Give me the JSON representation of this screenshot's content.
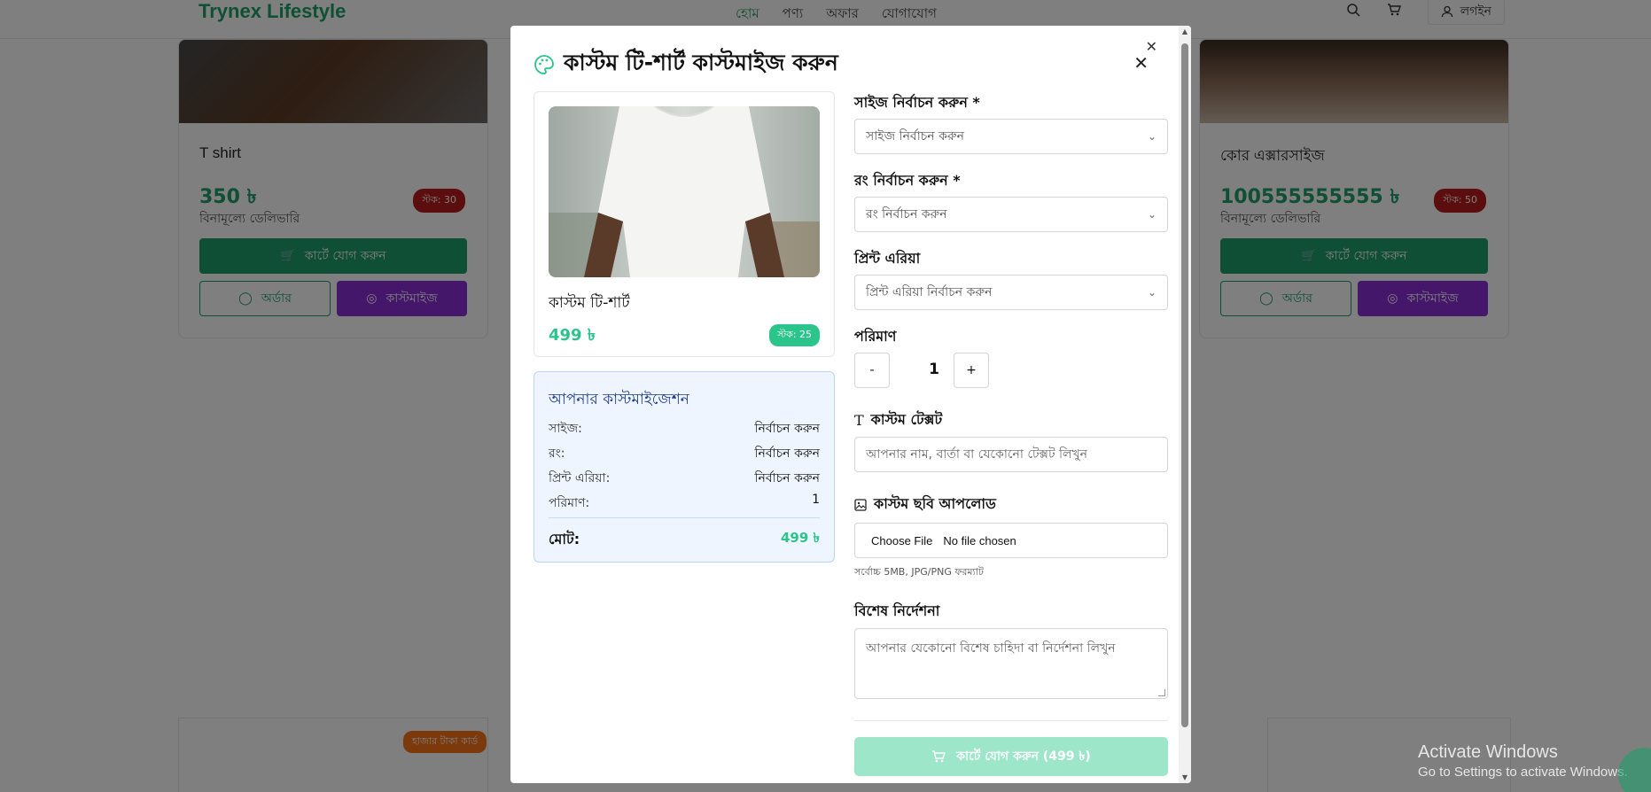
{
  "background": {
    "brand": "Trynex Lifestyle",
    "nav": [
      "হোম",
      "পণ্য",
      "অফার",
      "যোগাযোগ"
    ],
    "login_label": "লগইন",
    "cards": [
      {
        "title": "T shirt",
        "price": "350 ৳",
        "delivery": "বিনামূল্যে ডেলিভারি",
        "stock": "স্টক: 30",
        "add_to_cart": "কার্টে যোগ করুন",
        "order": "অর্ডার",
        "customize": "কাস্টমাইজ"
      },
      {
        "title": "কোর এক্সারসাইজ",
        "price": "100555555555 ৳",
        "delivery": "বিনামূল্যে ডেলিভারি",
        "stock": "স্টক: 50",
        "add_to_cart": "কার্টে যোগ করুন",
        "order": "অর্ডার",
        "customize": "কাস্টমাইজ"
      }
    ],
    "lower_badge": "হাজার টাকা কার্ড"
  },
  "modal": {
    "title": "কাস্টম টি-শার্ট কাস্টমাইজ করুন",
    "product": {
      "name": "কাস্টম টি-শার্ট",
      "price": "499 ৳",
      "stock": "স্টক: 25"
    },
    "summary": {
      "title": "আপনার কাস্টমাইজেশন",
      "rows": [
        {
          "label": "সাইজ:",
          "value": "নির্বাচন করুন"
        },
        {
          "label": "রং:",
          "value": "নির্বাচন করুন"
        },
        {
          "label": "প্রিন্ট এরিয়া:",
          "value": "নির্বাচন করুন"
        },
        {
          "label": "পরিমাণ:",
          "value": "1"
        }
      ],
      "total_label": "মোট:",
      "total_value": "499 ৳"
    },
    "form": {
      "size_label": "সাইজ নির্বাচন করুন *",
      "size_placeholder": "সাইজ নির্বাচন করুন",
      "color_label": "রং নির্বাচন করুন *",
      "color_placeholder": "রং নির্বাচন করুন",
      "print_label": "প্রিন্ট এরিয়া",
      "print_placeholder": "প্রিন্ট এরিয়া নির্বাচন করুন",
      "qty_label": "পরিমাণ",
      "qty_minus": "-",
      "qty_value": "1",
      "qty_plus": "+",
      "text_label": "কাস্টম টেক্সট",
      "text_placeholder": "আপনার নাম, বার্তা বা যেকোনো টেক্সট লিখুন",
      "image_label": "কাস্টম ছবি আপলোড",
      "file_button": "Choose File",
      "file_status": "No file chosen",
      "file_hint": "সর্বোচ্চ 5MB, JPG/PNG ফরম্যাট",
      "instructions_label": "বিশেষ নির্দেশনা",
      "instructions_placeholder": "আপনার যেকোনো বিশেষ চাহিদা বা নির্দেশনা লিখুন",
      "submit_label": "কার্টে যোগ করুন (499 ৳)"
    }
  },
  "os_watermark": {
    "line1": "Activate Windows",
    "line2": "Go to Settings to activate Windows."
  },
  "colors": {
    "brand_green": "#1d9e6b",
    "accent_green": "#2bc48a",
    "purple": "#8b2fd6",
    "summary_bg": "#eef5fe",
    "disabled_submit": "#9ee6c9"
  }
}
